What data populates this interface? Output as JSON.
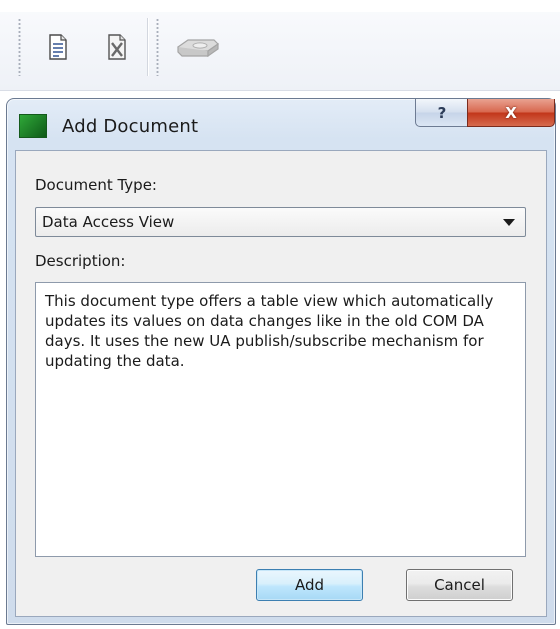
{
  "toolbar": {
    "icons": [
      "new-document-icon",
      "delete-document-icon",
      "server-icon"
    ]
  },
  "dialog": {
    "title": "Add Document",
    "help_glyph": "?",
    "close_glyph": "X",
    "document_type_label": "Document Type:",
    "document_type_value": "Data Access View",
    "description_label": "Description:",
    "description_text": "This document type offers a table view which automatically updates its values on data changes like in the old COM DA days. It uses the new UA publish/subscribe mechanism for updating the data.",
    "add_label": "Add",
    "cancel_label": "Cancel"
  },
  "colors": {
    "close_button": "#c7401f",
    "default_button_border": "#3c7fb1",
    "title_icon": "#1d7d27"
  }
}
